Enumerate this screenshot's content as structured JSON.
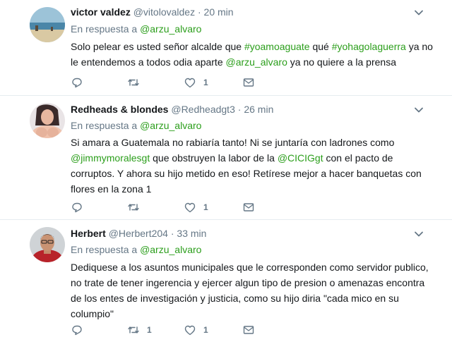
{
  "colors": {
    "mention": "#2b9e1b",
    "meta": "#657786",
    "border": "#e6ecf0"
  },
  "tweets": [
    {
      "name": "victor valdez",
      "handle": "@vitolovaldez",
      "sep": "·",
      "time": "20 min",
      "reply_prefix": "En respuesta a",
      "reply_to": "@arzu_alvaro",
      "body": [
        {
          "t": "Solo pelear es usted señor alcalde que ",
          "c": ""
        },
        {
          "t": "#yoamoaguate",
          "c": "green"
        },
        {
          "t": " qué ",
          "c": ""
        },
        {
          "t": "#yohagolaguerra",
          "c": "green"
        },
        {
          "t": " ya no le entendemos a todos odia aparte ",
          "c": ""
        },
        {
          "t": "@arzu_alvaro",
          "c": "green"
        },
        {
          "t": " ya no quiere a la prensa",
          "c": ""
        }
      ],
      "actions": {
        "reply_count": "",
        "retweet_count": "",
        "like_count": "1"
      }
    },
    {
      "name": "Redheads & blondes",
      "handle": "@Redheadgt3",
      "sep": "·",
      "time": "26 min",
      "reply_prefix": "En respuesta a",
      "reply_to": "@arzu_alvaro",
      "body": [
        {
          "t": "Si amara a Guatemala no rabiaría tanto! Ni se juntaría con ladrones como ",
          "c": ""
        },
        {
          "t": "@jimmymoralesgt",
          "c": "green"
        },
        {
          "t": " que obstruyen la labor de la ",
          "c": ""
        },
        {
          "t": "@CICIGgt",
          "c": "green"
        },
        {
          "t": " con el pacto de corruptos. Y ahora su hijo metido en eso! Retírese mejor a hacer banquetas con flores en la zona 1",
          "c": ""
        }
      ],
      "actions": {
        "reply_count": "",
        "retweet_count": "",
        "like_count": "1"
      }
    },
    {
      "name": "Herbert",
      "handle": "@Herbert204",
      "sep": "·",
      "time": "33 min",
      "reply_prefix": "En respuesta a",
      "reply_to": "@arzu_alvaro",
      "body": [
        {
          "t": "Dediquese a los asuntos municipales que le corresponden como servidor publico, no trate de tener ingerencia y ejercer algun tipo de presion o amenazas encontra de los entes de investigación y justicia, como su hijo diria \"cada mico en su columpio\"",
          "c": ""
        }
      ],
      "actions": {
        "reply_count": "",
        "retweet_count": "1",
        "like_count": "1"
      }
    }
  ]
}
